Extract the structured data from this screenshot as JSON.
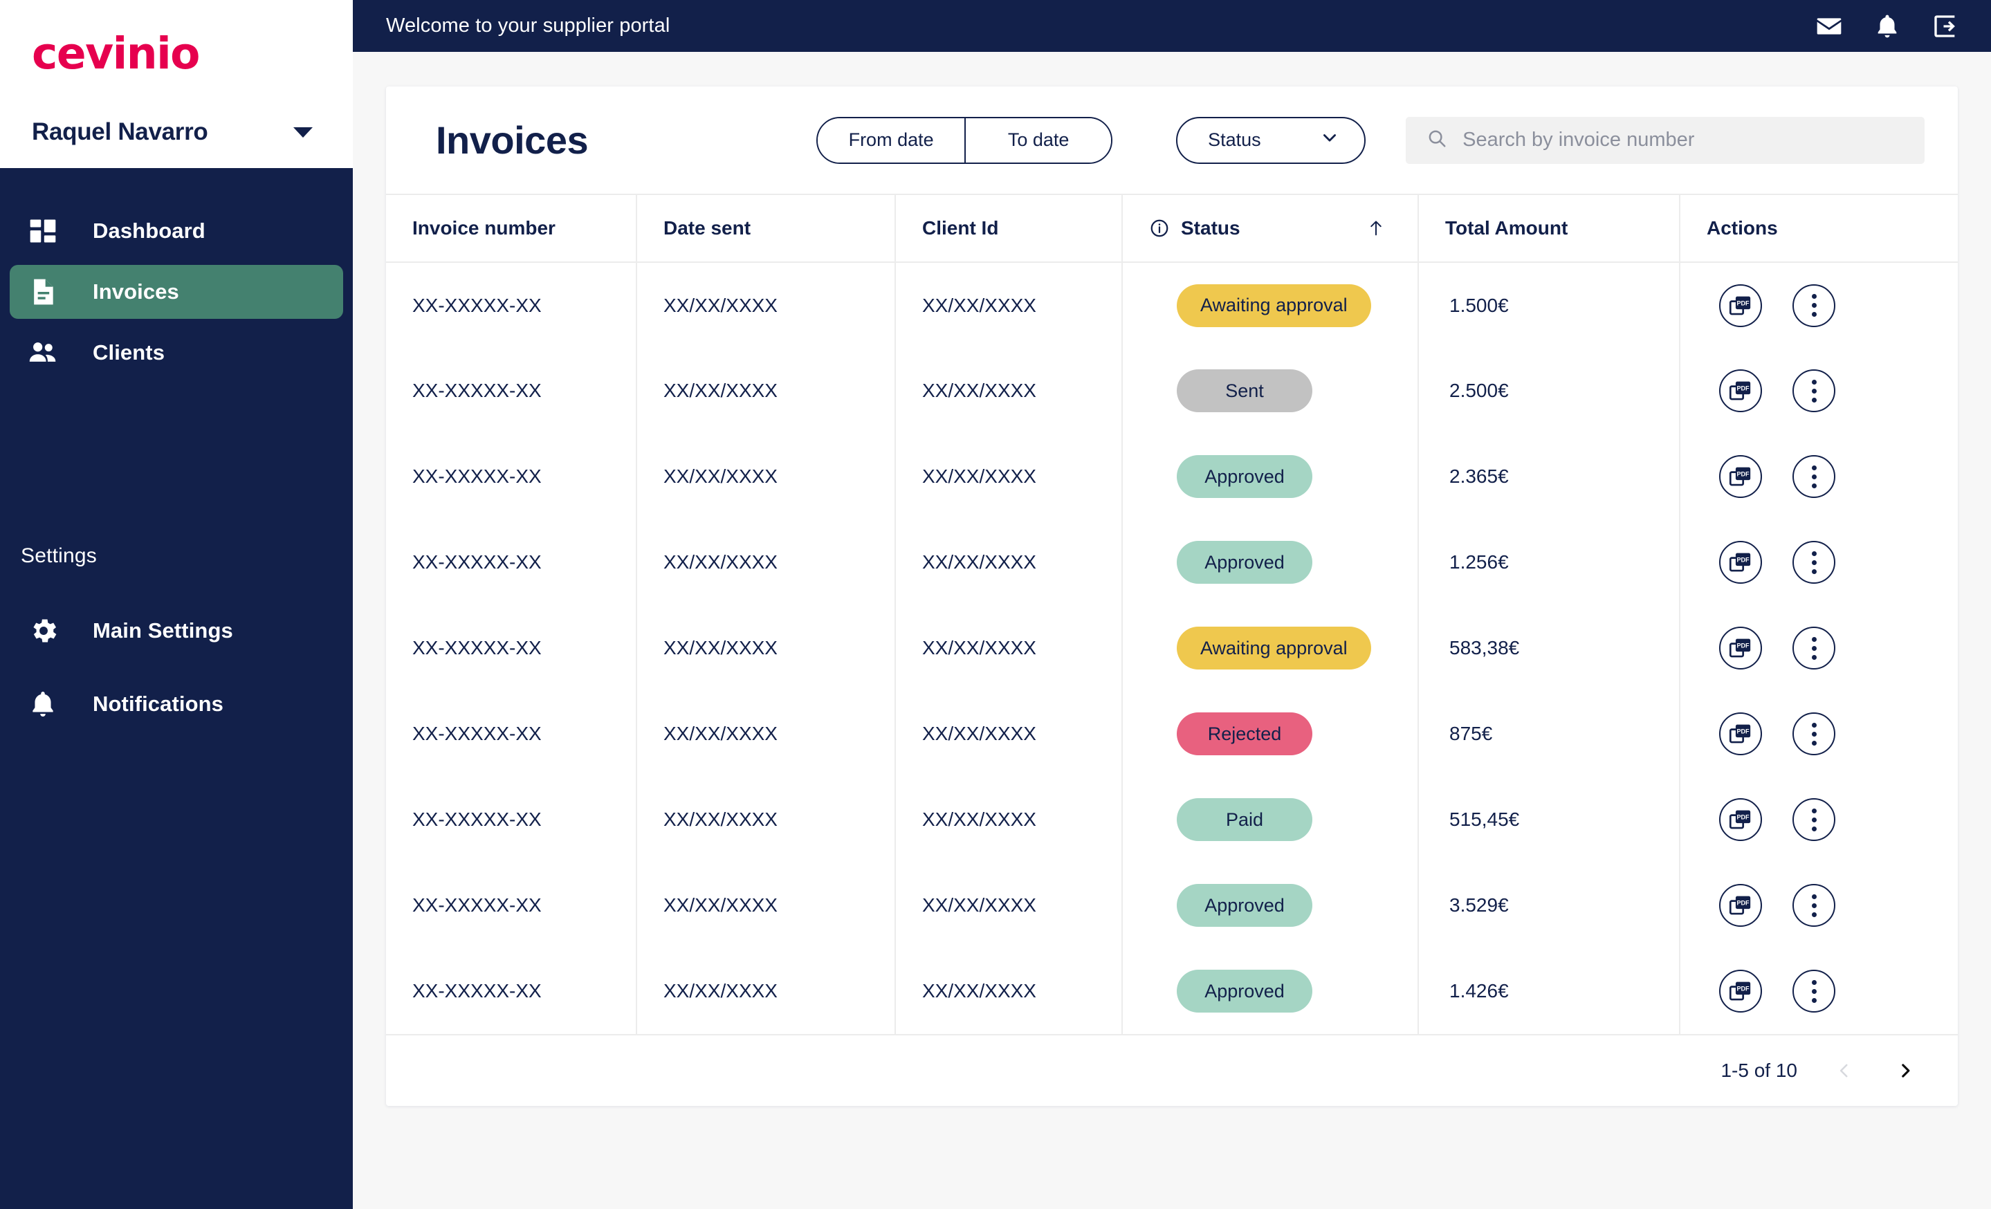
{
  "brand": {
    "logo_text": "cevinio",
    "logo_color": "#e6004e",
    "navy": "#12204a",
    "teal_active": "#44816f"
  },
  "sidebar": {
    "user_name": "Raquel Navarro",
    "nav_items": [
      {
        "label": "Dashboard",
        "icon": "dashboard-icon",
        "active": false
      },
      {
        "label": "Invoices",
        "icon": "document-icon",
        "active": true
      },
      {
        "label": "Clients",
        "icon": "people-icon",
        "active": false
      }
    ],
    "section_title": "Settings",
    "settings_items": [
      {
        "label": "Main Settings",
        "icon": "gear-icon"
      },
      {
        "label": "Notifications",
        "icon": "bell-icon"
      }
    ]
  },
  "topbar": {
    "title": "Welcome to your supplier portal",
    "icons": [
      "mail-icon",
      "bell-icon",
      "logout-icon"
    ]
  },
  "toolbar": {
    "page_title": "Invoices",
    "from_date_label": "From date",
    "to_date_label": "To date",
    "status_filter_label": "Status",
    "search_placeholder": "Search by invoice number",
    "search_value": ""
  },
  "table": {
    "columns": [
      "Invoice number",
      "Date sent",
      "Client Id",
      "Status",
      "Total Amount",
      "Actions"
    ],
    "status_sort": "ascending",
    "rows": [
      {
        "invoice_number": "XX-XXXXX-XX",
        "date_sent": "XX/XX/XXXX",
        "client_id": "XX/XX/XXXX",
        "status": "Awaiting approval",
        "status_kind": "awaiting",
        "total_amount": "1.500€"
      },
      {
        "invoice_number": "XX-XXXXX-XX",
        "date_sent": "XX/XX/XXXX",
        "client_id": "XX/XX/XXXX",
        "status": "Sent",
        "status_kind": "sent",
        "total_amount": "2.500€"
      },
      {
        "invoice_number": "XX-XXXXX-XX",
        "date_sent": "XX/XX/XXXX",
        "client_id": "XX/XX/XXXX",
        "status": "Approved",
        "status_kind": "approved",
        "total_amount": "2.365€"
      },
      {
        "invoice_number": "XX-XXXXX-XX",
        "date_sent": "XX/XX/XXXX",
        "client_id": "XX/XX/XXXX",
        "status": "Approved",
        "status_kind": "approved",
        "total_amount": "1.256€"
      },
      {
        "invoice_number": "XX-XXXXX-XX",
        "date_sent": "XX/XX/XXXX",
        "client_id": "XX/XX/XXXX",
        "status": "Awaiting approval",
        "status_kind": "awaiting",
        "total_amount": "583,38€"
      },
      {
        "invoice_number": "XX-XXXXX-XX",
        "date_sent": "XX/XX/XXXX",
        "client_id": "XX/XX/XXXX",
        "status": "Rejected",
        "status_kind": "rejected",
        "total_amount": "875€"
      },
      {
        "invoice_number": "XX-XXXXX-XX",
        "date_sent": "XX/XX/XXXX",
        "client_id": "XX/XX/XXXX",
        "status": "Paid",
        "status_kind": "paid",
        "total_amount": "515,45€"
      },
      {
        "invoice_number": "XX-XXXXX-XX",
        "date_sent": "XX/XX/XXXX",
        "client_id": "XX/XX/XXXX",
        "status": "Approved",
        "status_kind": "approved",
        "total_amount": "3.529€"
      },
      {
        "invoice_number": "XX-XXXXX-XX",
        "date_sent": "XX/XX/XXXX",
        "client_id": "XX/XX/XXXX",
        "status": "Approved",
        "status_kind": "approved",
        "total_amount": "1.426€"
      }
    ],
    "row_action_icons": [
      "pdf-icon",
      "more-vertical-icon"
    ]
  },
  "pagination": {
    "range_text": "1-5 of 10",
    "prev_enabled": false,
    "next_enabled": true
  },
  "status_colors": {
    "awaiting": "#efc84e",
    "sent": "#c2c2c2",
    "approved": "#a5d5c4",
    "rejected": "#e8617f",
    "paid": "#a5d5c4"
  }
}
